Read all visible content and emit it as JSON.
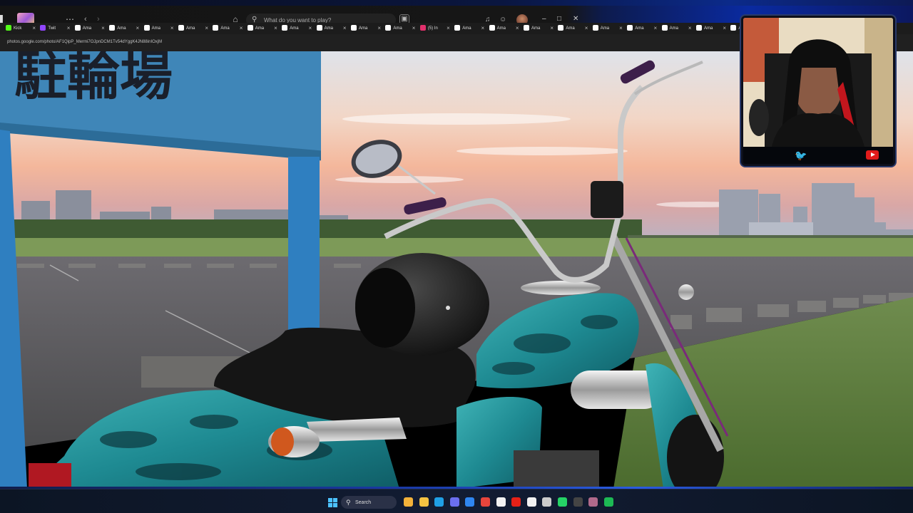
{
  "header": {
    "search_placeholder": "What do you want to play?",
    "more_icon": "⋯",
    "back_icon": "‹",
    "forward_icon": "›",
    "home_icon": "⌂",
    "search_icon": "⚲"
  },
  "tabs": [
    {
      "label": "Kick",
      "color": "#53fc18"
    },
    {
      "label": "Twit",
      "color": "#9146ff"
    },
    {
      "label": "Ama",
      "color": "#ffffff"
    },
    {
      "label": "Ama",
      "color": "#ffffff"
    },
    {
      "label": "Ama",
      "color": "#ffffff"
    },
    {
      "label": "Ama",
      "color": "#ffffff"
    },
    {
      "label": "Ama",
      "color": "#ffffff"
    },
    {
      "label": "Ama",
      "color": "#ffffff"
    },
    {
      "label": "Ama",
      "color": "#ffffff"
    },
    {
      "label": "Ama",
      "color": "#ffffff"
    },
    {
      "label": "Ama",
      "color": "#ffffff"
    },
    {
      "label": "Ama",
      "color": "#ffffff"
    },
    {
      "label": "(5) In",
      "color": "#e1306c"
    },
    {
      "label": "Ama",
      "color": "#ffffff"
    },
    {
      "label": "Ama",
      "color": "#ffffff"
    },
    {
      "label": "Ama",
      "color": "#ffffff"
    },
    {
      "label": "Ama",
      "color": "#ffffff"
    },
    {
      "label": "Ama",
      "color": "#ffffff"
    },
    {
      "label": "Ama",
      "color": "#ffffff"
    },
    {
      "label": "Ama",
      "color": "#ffffff"
    },
    {
      "label": "Ama",
      "color": "#ffffff"
    },
    {
      "label": "Ama",
      "color": "#ffffff"
    },
    {
      "label": "Ama",
      "color": "#ffffff"
    }
  ],
  "tab_close_glyph": "×",
  "address_bar": {
    "url": "photos.google.com/photo/AF1QipP_Mermi7OJpnDCM1Tv54dYggK4JN88inIOxjM"
  },
  "photo": {
    "sign_text": "駐輪場"
  },
  "taskbar": {
    "search_label": "Search",
    "apps": [
      {
        "name": "widgets",
        "color": "#f3b23a"
      },
      {
        "name": "file-explorer",
        "color": "#f5c342"
      },
      {
        "name": "edge",
        "color": "#1fa0e6"
      },
      {
        "name": "copilot",
        "color": "#6b6ff0"
      },
      {
        "name": "store",
        "color": "#2f86f0"
      },
      {
        "name": "chrome",
        "color": "#e8453c"
      },
      {
        "name": "calendar",
        "color": "#f2f2f2"
      },
      {
        "name": "youtube",
        "color": "#e62117"
      },
      {
        "name": "capcut",
        "color": "#f2f2f2"
      },
      {
        "name": "github",
        "color": "#cccccc"
      },
      {
        "name": "whatsapp",
        "color": "#25d366"
      },
      {
        "name": "obs",
        "color": "#444444"
      },
      {
        "name": "discord-profile",
        "color": "#b06a8b"
      },
      {
        "name": "spotify",
        "color": "#1db954"
      }
    ]
  }
}
